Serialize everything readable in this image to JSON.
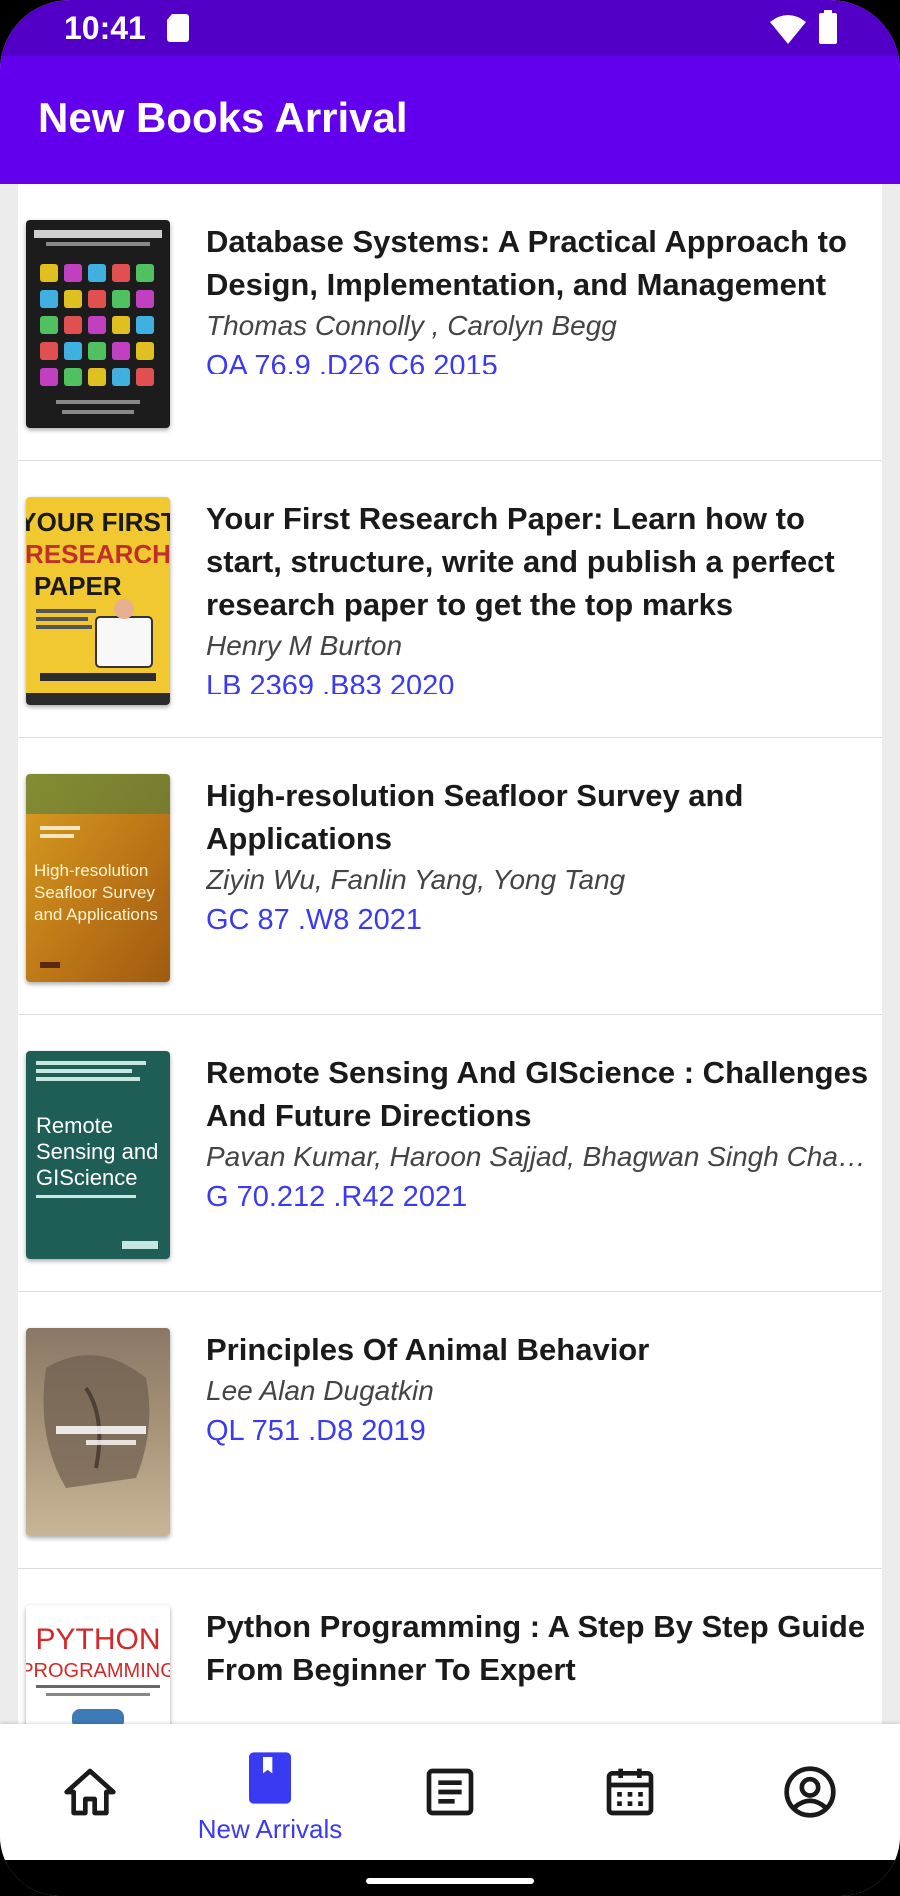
{
  "status": {
    "time": "10:41"
  },
  "appbar": {
    "title": "New Books Arrival"
  },
  "books": [
    {
      "title": "Database Systems: A Practical Approach to Design, Implementation, and Management",
      "authors": " Thomas Connolly , Carolyn Begg",
      "call_number": "QA 76.9 .D26 C6 2015"
    },
    {
      "title": "Your First Research Paper: Learn how to start, structure, write and publish a perfect research paper to get the top marks",
      "authors": "Henry M Burton",
      "call_number": "LB 2369 .B83 2020",
      "cover_text": [
        "YOUR FIRST",
        "RESEARCH",
        "PAPER"
      ]
    },
    {
      "title": "High-resolution Seafloor Survey and Applications",
      "authors": "Ziyin Wu, Fanlin Yang, Yong Tang",
      "call_number": "GC 87 .W8 2021",
      "cover_text": [
        "High-resolution",
        "Seafloor Survey",
        "and Applications"
      ]
    },
    {
      "title": "Remote Sensing And GIScience : Challenges And Future Directions",
      "authors": "Pavan Kumar, Haroon Sajjad, Bhagwan Singh Chaudhary",
      "call_number": "G 70.212 .R42 2021",
      "cover_text": [
        "Remote",
        "Sensing and",
        "GIScience"
      ]
    },
    {
      "title": "Principles Of Animal Behavior",
      "authors": "Lee Alan Dugatkin",
      "call_number": "QL 751 .D8 2019"
    },
    {
      "title": "Python Programming : A Step By Step Guide From Beginner To Expert",
      "authors": "",
      "call_number": "",
      "cover_text": [
        "PYTHON",
        "PROGRAMMING"
      ]
    }
  ],
  "nav": {
    "active_label": "New Arrivals",
    "icons": [
      "home-icon",
      "bookmark-icon",
      "article-icon",
      "calendar-icon",
      "account-icon"
    ]
  },
  "colors": {
    "statusbar": "#5200c8",
    "appbar": "#6200ee",
    "accent": "#3a3af2"
  }
}
